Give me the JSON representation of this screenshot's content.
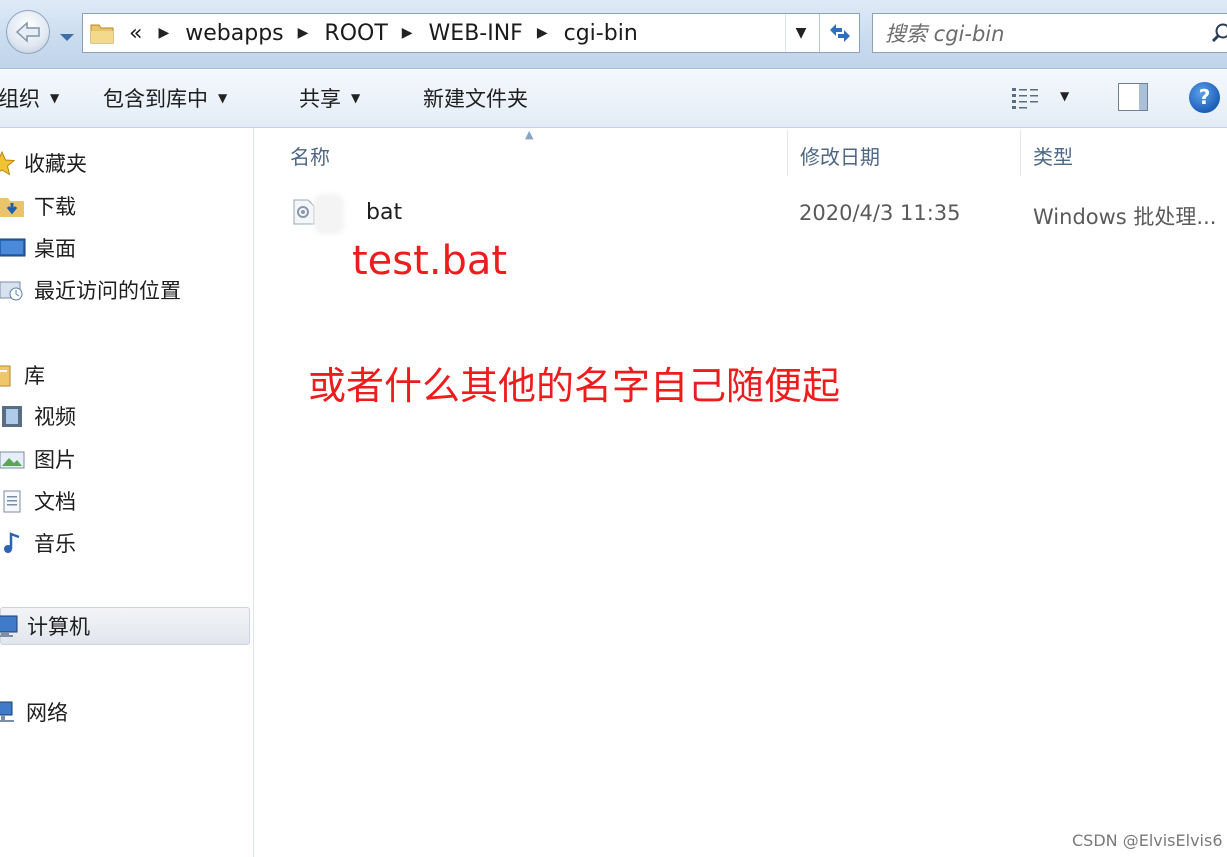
{
  "address": {
    "overflow": "«",
    "crumbs": [
      "webapps",
      "ROOT",
      "WEB-INF",
      "cgi-bin"
    ],
    "search_placeholder": "搜索 cgi-bin"
  },
  "toolbar": {
    "organize": "组织",
    "include_library": "包含到库中",
    "share": "共享",
    "new_folder": "新建文件夹"
  },
  "nav": {
    "favorites": "收藏夹",
    "downloads": "下载",
    "desktop": "桌面",
    "recent": "最近访问的位置",
    "libraries": "库",
    "videos": "视频",
    "pictures": "图片",
    "documents": "文档",
    "music": "音乐",
    "computer": "计算机",
    "network": "网络"
  },
  "columns": {
    "name": "名称",
    "date": "修改日期",
    "type": "类型"
  },
  "files": [
    {
      "name": "bat",
      "date": "2020/4/3 11:35",
      "type": "Windows 批处理..."
    }
  ],
  "annotations": {
    "filename": "test.bat",
    "note": "或者什么其他的名字自己随便起"
  },
  "watermark": "CSDN @ElvisElvis6",
  "colors": {
    "annotation_red": "#ee1c1c",
    "header_text": "#4d6785",
    "chrome_blue": "#c9dbef"
  }
}
